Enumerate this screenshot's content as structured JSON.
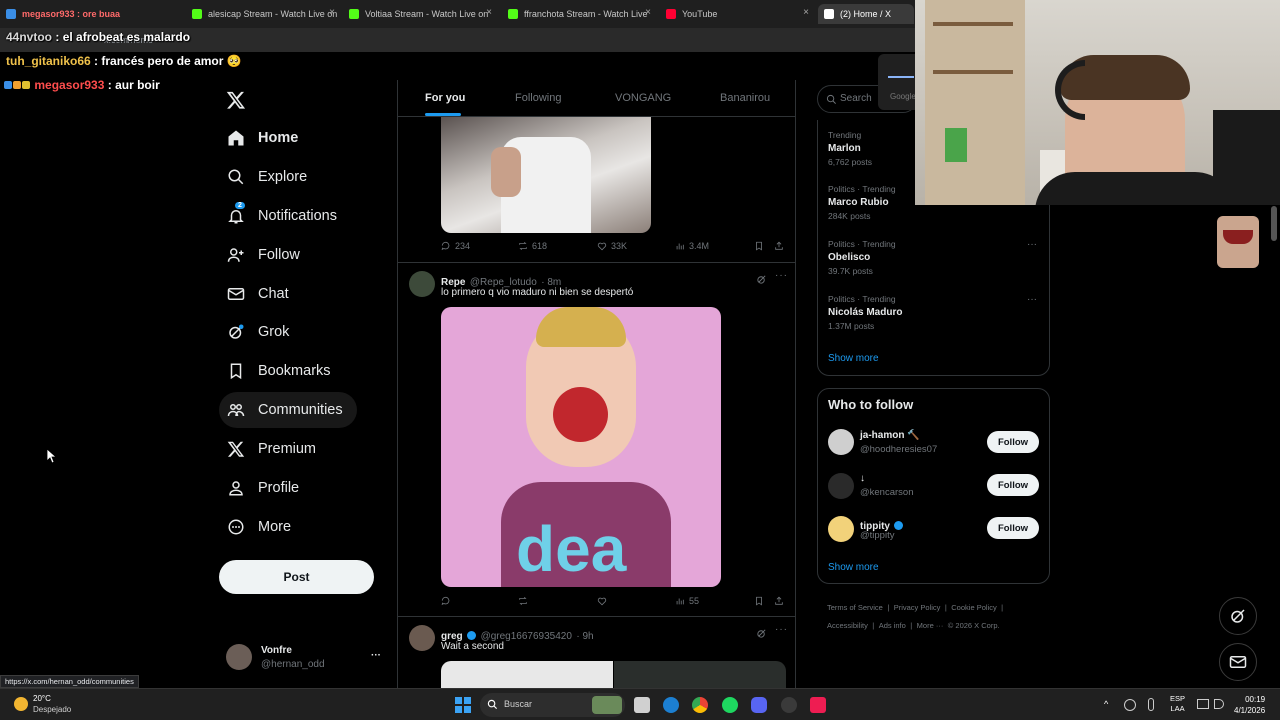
{
  "browser": {
    "tabs": [
      {
        "label": "megasor933 : ore buaa",
        "close": "×"
      },
      {
        "label": "alesicap Stream - Watch Live on",
        "close": "×"
      },
      {
        "label": "Voltiaa Stream - Watch Live on",
        "close": "×"
      },
      {
        "label": "ffranchota Stream - Watch Live",
        "close": "×"
      },
      {
        "label": "YouTube",
        "close": "×"
      },
      {
        "label": "(2) Home / X",
        "close": "×"
      }
    ],
    "url": "x.com/home",
    "status_url": "https://x.com/hernan_odd/communities"
  },
  "chat": [
    {
      "user": "44nvtoo",
      "text": ": el afrobeat es malardo"
    },
    {
      "user": "tuh_gitaniko66",
      "text": ": francés pero de amor 🥺"
    },
    {
      "user": "megasor933",
      "text": ": aur boir"
    }
  ],
  "sidebar": {
    "items": [
      {
        "label": "Home",
        "icon": "home-icon"
      },
      {
        "label": "Explore",
        "icon": "search-icon"
      },
      {
        "label": "Notifications",
        "icon": "bell-icon",
        "badge": "2"
      },
      {
        "label": "Follow",
        "icon": "person-add-icon"
      },
      {
        "label": "Chat",
        "icon": "mail-icon"
      },
      {
        "label": "Grok",
        "icon": "grok-icon"
      },
      {
        "label": "Bookmarks",
        "icon": "bookmark-icon"
      },
      {
        "label": "Communities",
        "icon": "communities-icon"
      },
      {
        "label": "Premium",
        "icon": "x-logo-icon"
      },
      {
        "label": "Profile",
        "icon": "person-icon"
      },
      {
        "label": "More",
        "icon": "more-circle-icon"
      }
    ],
    "post_label": "Post",
    "account": {
      "name": "Vonfre",
      "handle": "@hernan_odd",
      "more": "···"
    }
  },
  "feed": {
    "tabs": [
      "For you",
      "Following",
      "VONGANG",
      "Bananirou"
    ],
    "tweet1": {
      "replies": "234",
      "retweets": "618",
      "likes": "33K",
      "views": "3.4M"
    },
    "tweet2": {
      "name": "Repe",
      "handle": "@Repe_lotudo",
      "time": "· 8m",
      "text": "lo primero q vio maduro ni bien se despertó",
      "image_text": "dea",
      "views": "55"
    },
    "tweet3": {
      "name": "greg",
      "handle": "@greg16676935420",
      "time": "· 9h",
      "text": "Wait a second"
    }
  },
  "right": {
    "search_placeholder": "Search",
    "trends": [
      {
        "meta": "Trending",
        "name": "Marlon",
        "posts": "6,762 posts"
      },
      {
        "meta": "Politics · Trending",
        "name": "Marco Rubio",
        "posts": "284K posts"
      },
      {
        "meta": "Politics · Trending",
        "name": "Obelisco",
        "posts": "39.7K posts"
      },
      {
        "meta": "Politics · Trending",
        "name": "Nicolás Maduro",
        "posts": "1.37M posts"
      }
    ],
    "show_more": "Show more",
    "who_to_follow_title": "Who to follow",
    "follow_suggestions": [
      {
        "name": "ja-hamon 🔨",
        "handle": "@hoodheresies07",
        "button": "Follow"
      },
      {
        "name": "↓",
        "handle": "@kencarson",
        "button": "Follow"
      },
      {
        "name": "tippity",
        "handle": "@tippity",
        "button": "Follow",
        "verified": true
      }
    ],
    "show_more_2": "Show more",
    "footer": [
      "Terms of Service",
      "|",
      "Privacy Policy",
      "|",
      "Cookie Policy",
      "|",
      "Accessibility",
      "|",
      "Ads info",
      "|",
      "More ···",
      "© 2026 X Corp."
    ]
  },
  "webcam": {
    "overlay_text": "Google"
  },
  "taskbar": {
    "weather_temp": "20°C",
    "weather_desc": "Despejado",
    "search_label": "Buscar",
    "lang_top": "ESP",
    "lang_bottom": "LAA",
    "time": "00:19",
    "date": "4/1/2026"
  },
  "colors": {
    "accent": "#1d9bf0",
    "bg": "#000000",
    "border": "#2f3336",
    "muted": "#71767b"
  }
}
